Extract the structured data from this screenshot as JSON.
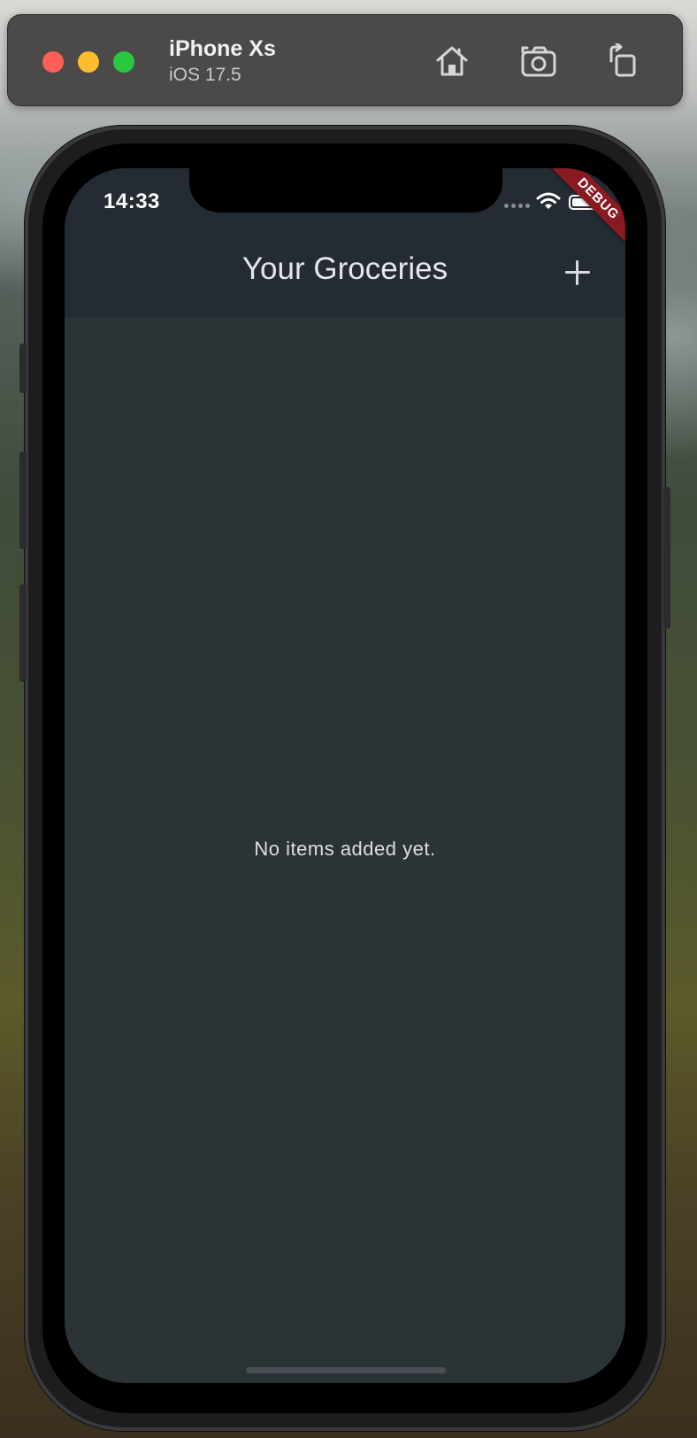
{
  "simulator": {
    "device_name": "iPhone Xs",
    "os_version": "iOS 17.5",
    "buttons": {
      "home": "home-icon",
      "screenshot": "camera-icon",
      "rotate": "rotate-icon"
    }
  },
  "status_bar": {
    "time": "14:33"
  },
  "debug_banner": "DEBUG",
  "app_bar": {
    "title": "Your Groceries",
    "action_icon": "plus-icon"
  },
  "body": {
    "empty_message": "No items added yet."
  },
  "colors": {
    "app_bar_bg": "#252b33",
    "screen_bg": "#2c3336",
    "debug_banner": "#8a1a22"
  }
}
